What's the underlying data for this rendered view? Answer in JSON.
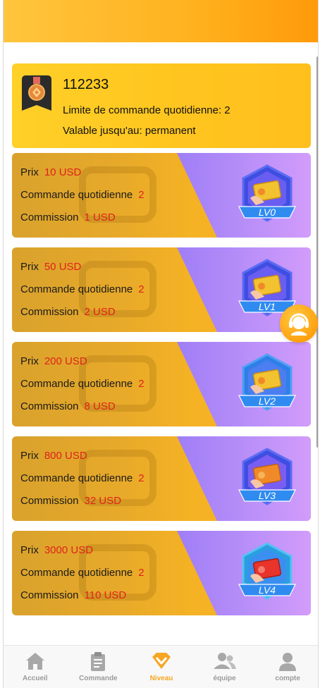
{
  "account": {
    "user_id": "112233",
    "daily_limit": "Limite de commande quotidienne: 2",
    "valid_until": "Valable jusqu'au: permanent"
  },
  "labels": {
    "price": "Prix",
    "daily_orders": "Commande quotidienne",
    "commission": "Commission"
  },
  "levels": [
    {
      "name": "LV0",
      "price": "10 USD",
      "daily_orders": "2",
      "commission": "1 USD",
      "card_color": "#f2c230"
    },
    {
      "name": "LV1",
      "price": "50 USD",
      "daily_orders": "2",
      "commission": "2 USD",
      "card_color": "#f2c230"
    },
    {
      "name": "LV2",
      "price": "200 USD",
      "daily_orders": "2",
      "commission": "8 USD",
      "card_color": "#f2c230"
    },
    {
      "name": "LV3",
      "price": "800 USD",
      "daily_orders": "2",
      "commission": "32 USD",
      "card_color": "#f08a28"
    },
    {
      "name": "LV4",
      "price": "3000 USD",
      "daily_orders": "2",
      "commission": "110 USD",
      "card_color": "#e8342b"
    }
  ],
  "tabbar": {
    "items": [
      {
        "label": "Accueil",
        "icon": "home-icon",
        "active": false
      },
      {
        "label": "Commande",
        "icon": "clipboard-icon",
        "active": false
      },
      {
        "label": "Niveau",
        "icon": "diamond-icon",
        "active": true
      },
      {
        "label": "équipe",
        "icon": "team-icon",
        "active": false
      },
      {
        "label": "compte",
        "icon": "user-icon",
        "active": false
      }
    ]
  },
  "colors": {
    "accent": "#f5a623",
    "value_red": "#e0221c",
    "header_orange": "#ffb21e"
  }
}
